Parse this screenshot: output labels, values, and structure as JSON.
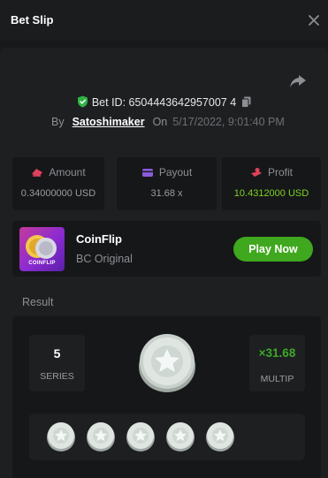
{
  "header": {
    "title": "Bet Slip"
  },
  "bet": {
    "id_label": "Bet ID: 6504443642957007 4",
    "by_label": "By",
    "user": "Satoshimaker",
    "on_label": "On",
    "date": "5/17/2022, 9:01:40 PM"
  },
  "stats": {
    "amount": {
      "label": "Amount",
      "value": "0.34000000 USD"
    },
    "payout": {
      "label": "Payout",
      "value": "31.68 x"
    },
    "profit": {
      "label": "Profit",
      "value": "10.4312000 USD"
    }
  },
  "game": {
    "name": "CoinFlip",
    "subtitle": "BC Original",
    "thumb_text": "COINFLIP",
    "play_label": "Play Now"
  },
  "result": {
    "label": "Result",
    "series_value": "5",
    "series_caption": "SERIES",
    "multiplier": "×31.68",
    "multiplier_caption": "MULTIP",
    "coins": [
      "silver",
      "silver",
      "silver",
      "silver",
      "silver"
    ]
  },
  "colors": {
    "accent_green": "#3fa81e",
    "profit_green": "#7ed321",
    "shield_green": "#2fb344",
    "background": "#18191b"
  }
}
